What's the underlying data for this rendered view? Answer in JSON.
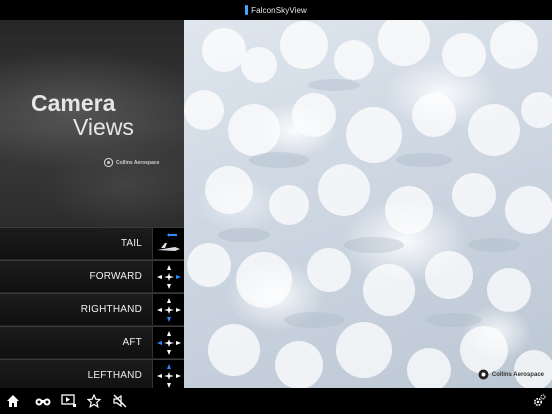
{
  "app": {
    "title": "FalconSkyView"
  },
  "brand": {
    "title_line1": "Camera",
    "title_line2": "Views",
    "logo_text": "Collins Aerospace"
  },
  "camera_views": [
    {
      "label": "TAIL",
      "selected": true,
      "icon": "tail-camera-thumbnail"
    },
    {
      "label": "FORWARD",
      "icon": "forward-direction-icon"
    },
    {
      "label": "RIGHTHAND",
      "icon": "righthand-direction-icon"
    },
    {
      "label": "AFT",
      "icon": "aft-direction-icon"
    },
    {
      "label": "LEFTHAND",
      "icon": "lefthand-direction-icon"
    }
  ],
  "main_view": {
    "watermark_text": "Collins Aerospace"
  },
  "toolbar": {
    "icons": [
      "home-icon",
      "binoculars-icon",
      "video-icon",
      "star-icon",
      "sound-off-icon",
      "settings-icon"
    ]
  },
  "colors": {
    "accent": "#2e8bff",
    "panel_bg": "#2b2b2b",
    "toolbar_bg": "#000000"
  }
}
